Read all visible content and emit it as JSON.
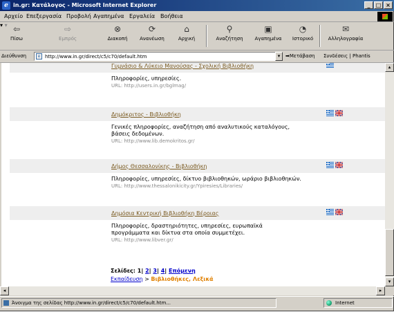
{
  "window": {
    "title": "in.gr: Κατάλογος - Microsoft Internet Explorer"
  },
  "menu": [
    "Αρχείο",
    "Επεξεργασία",
    "Προβολή",
    "Αγαπημένα",
    "Εργαλεία",
    "Βοήθεια"
  ],
  "toolbar": {
    "back": "Πίσω",
    "forward": "Εμπρός",
    "stop": "Διακοπή",
    "refresh": "Ανανέωση",
    "home": "Αρχική",
    "search": "Αναζήτηση",
    "favorites": "Αγαπημένα",
    "history": "Ιστορικό",
    "mail": "Αλληλογραφία"
  },
  "address": {
    "label": "Διεύθυνση",
    "url": "http://www.in.gr/direct/c5/c70/default.htm",
    "go": "Μετάβαση",
    "links": "Συνδέσεις",
    "phantis": "Phantis"
  },
  "entries": [
    {
      "title": "Γυμνάσιο & Λύκειο Μανούσας - Σχολική Βιβλιοθήκη",
      "desc": "Πληροφορίες, υπηρεσίες.",
      "url": "URL: http://users.in.gr/bglmag/",
      "flags": [
        "greek-flag"
      ]
    },
    {
      "title": "Δημόκριτος - Βιβλιοθήκη",
      "desc": "Γενικές πληροφορίες, αναζήτηση από αναλυτικούς καταλόγους, βάσεις δεδομένων.",
      "url": "URL: http://www.lib.demokritos.gr/",
      "flags": [
        "greek-flag",
        "uk-flag"
      ]
    },
    {
      "title": "Δήμος Θεσσαλονίκης - Βιβλιοθήκη",
      "desc": "Πληροφορίες, υπηρεσίες, δίκτυο βιβλιοθηκών, ωράριο βιβλιοθηκών.",
      "url": "URL: http://www.thessalonikicity.gr/Ypiresies/Libraries/",
      "flags": [
        "greek-flag",
        "uk-flag"
      ]
    },
    {
      "title": "Δημόσια Κεντρική Βιβλιοθήκη Βέροιας",
      "desc": "Πληροφορίες, δραστηριότητες, υπηρεσίες, ευρωπαϊκά προγράμματα και δίκτυα στα οποία συμμετέχει.",
      "url": "URL: http://www.libver.gr/",
      "flags": [
        "greek-flag",
        "uk-flag"
      ]
    }
  ],
  "pager": {
    "label": "Σελίδες:",
    "current": "1",
    "pages": [
      "2",
      "3",
      "4"
    ],
    "next": "Επόμενη"
  },
  "breadcrumb": {
    "parent": "Εκπαίδευση",
    "sep": " > ",
    "current": "Βιβλιοθήκες, Λεξικά"
  },
  "status": {
    "message": "Άνοιγμα της σελίδας http://www.in.gr/direct/c5/c70/default.htm...",
    "zone": "Internet"
  },
  "colors": {
    "link": "#7a5a20",
    "header_bg": "#eeeeee",
    "breadcrumb_current": "#e08000"
  }
}
